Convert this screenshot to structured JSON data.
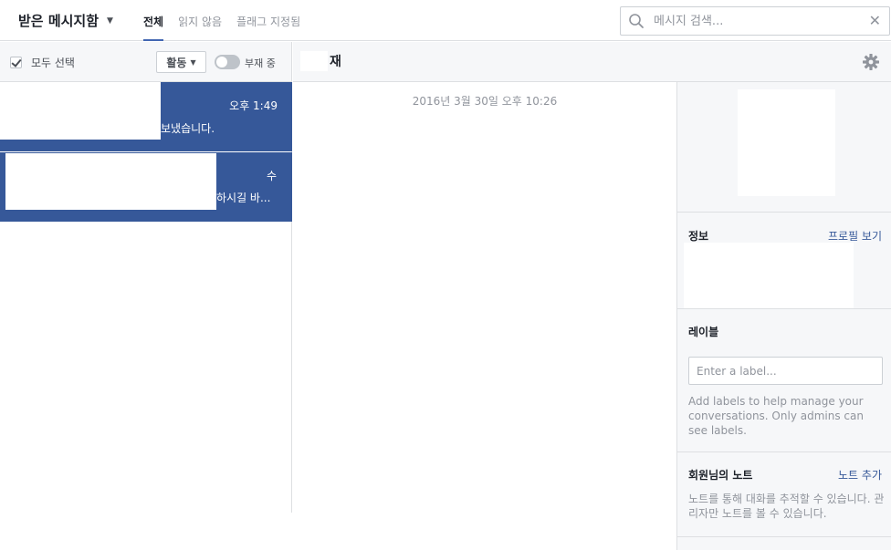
{
  "header": {
    "inbox_title": "받은 메시지함",
    "tabs": [
      {
        "label": "전체",
        "active": true
      },
      {
        "label": "읽지 않음",
        "active": false
      },
      {
        "label": "플래그 지정됨",
        "active": false
      }
    ],
    "search_placeholder": "메시지 검색..."
  },
  "toolbar": {
    "select_all_label": "모두 선택",
    "activity_label": "활동",
    "away_label": "부재 중"
  },
  "threads": [
    {
      "time": "오후 1:49",
      "snippet": "보냈습니다."
    },
    {
      "time": "수",
      "snippet": "하시길 바..."
    }
  ],
  "conversation": {
    "name_suffix": "재",
    "date": "2016년 3월 30일 오후 10:26"
  },
  "info_pane": {
    "info_title": "정보",
    "profile_link": "프로필 보기",
    "labels_title": "레이블",
    "label_placeholder": "Enter a label...",
    "labels_help": "Add labels to help manage your conversations. Only admins can see labels.",
    "notes_title": "회원님의 노트",
    "add_note_link": "노트 추가",
    "notes_help": "노트를 통해 대화를 추적할 수 있습니다. 관리자만 노트를 볼 수 있습니다."
  },
  "colors": {
    "accent": "#365899",
    "border": "#dddfe2",
    "panel_bg": "#f6f7f9",
    "muted_text": "#90949c"
  },
  "icons": {
    "search": "search-icon",
    "clear": "close-icon",
    "settings": "gear-icon",
    "dropdown": "caret-down-icon"
  }
}
